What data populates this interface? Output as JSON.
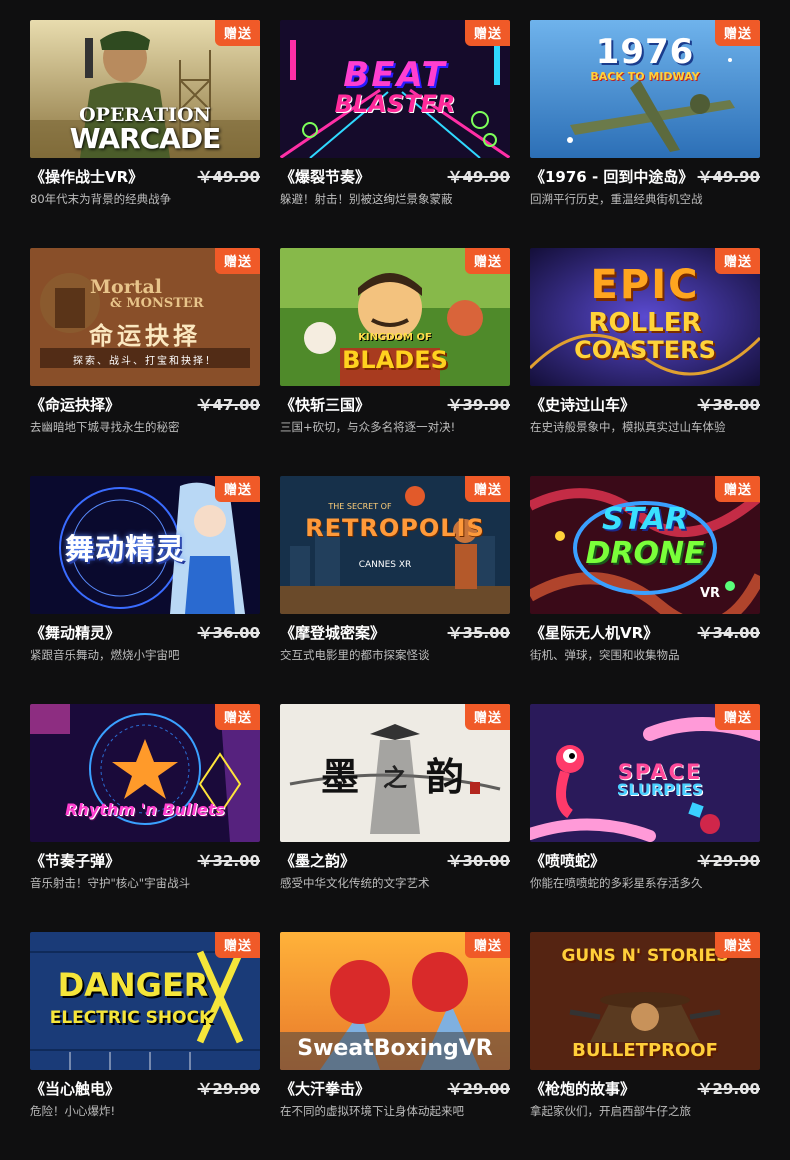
{
  "badge_label": "赠送",
  "games": [
    {
      "title": "《操作战士VR》",
      "price": "￥49.90",
      "desc": "80年代末为背景的经典战争",
      "art": "OPERATION WARCADE"
    },
    {
      "title": "《爆裂节奏》",
      "price": "￥49.90",
      "desc": "躲避！射击！别被这绚烂景象蒙蔽",
      "art": "BEAT BLASTER"
    },
    {
      "title": "《1976 - 回到中途岛》",
      "price": "￥49.90",
      "desc": "回溯平行历史，重温经典街机空战",
      "art": "1976 BACK TO MIDWAY"
    },
    {
      "title": "《命运抉择》",
      "price": "￥47.00",
      "desc": "去幽暗地下城寻找永生的秘密",
      "art": "MORTAL & MONSTER 命运抉择 探索、战斗、打宝和抉择！"
    },
    {
      "title": "《快斩三国》",
      "price": "￥39.90",
      "desc": "三国+砍切，与众多名将逐一对决!",
      "art": "KINGDOM OF BLADES"
    },
    {
      "title": "《史诗过山车》",
      "price": "￥38.00",
      "desc": "在史诗般景象中，模拟真实过山车体验",
      "art": "EPIC ROLLER COASTERS"
    },
    {
      "title": "《舞动精灵》",
      "price": "￥36.00",
      "desc": "紧跟音乐舞动，燃烧小宇宙吧",
      "art": "舞动精灵"
    },
    {
      "title": "《摩登城密案》",
      "price": "￥35.00",
      "desc": "交互式电影里的都市探案怪谈",
      "art": "THE SECRET OF RETROPOLIS CANNES XR"
    },
    {
      "title": "《星际无人机VR》",
      "price": "￥34.00",
      "desc": "街机、弹球，突围和收集物品",
      "art": "STAR DRONE VR"
    },
    {
      "title": "《节奏子弹》",
      "price": "￥32.00",
      "desc": "音乐射击！守护\"核心\"宇宙战斗",
      "art": "Rhythm 'n Bullets"
    },
    {
      "title": "《墨之韵》",
      "price": "￥30.00",
      "desc": "感受中华文化传统的文字艺术",
      "art": "墨之韵"
    },
    {
      "title": "《喷喷蛇》",
      "price": "￥29.90",
      "desc": "你能在喷喷蛇的多彩星系存活多久",
      "art": "SPACE SLURPIES"
    },
    {
      "title": "《当心触电》",
      "price": "￥29.90",
      "desc": "危险！小心爆炸!",
      "art": "DANGER ELECTRIC SHOCK"
    },
    {
      "title": "《大汗拳击》",
      "price": "￥29.00",
      "desc": "在不同的虚拟环境下让身体动起来吧",
      "art": "SweatBoxingVR"
    },
    {
      "title": "《枪炮的故事》",
      "price": "￥29.00",
      "desc": "拿起家伙们，开启西部牛仔之旅",
      "art": "GUNS N' STORIES BULLETPROOF"
    }
  ]
}
